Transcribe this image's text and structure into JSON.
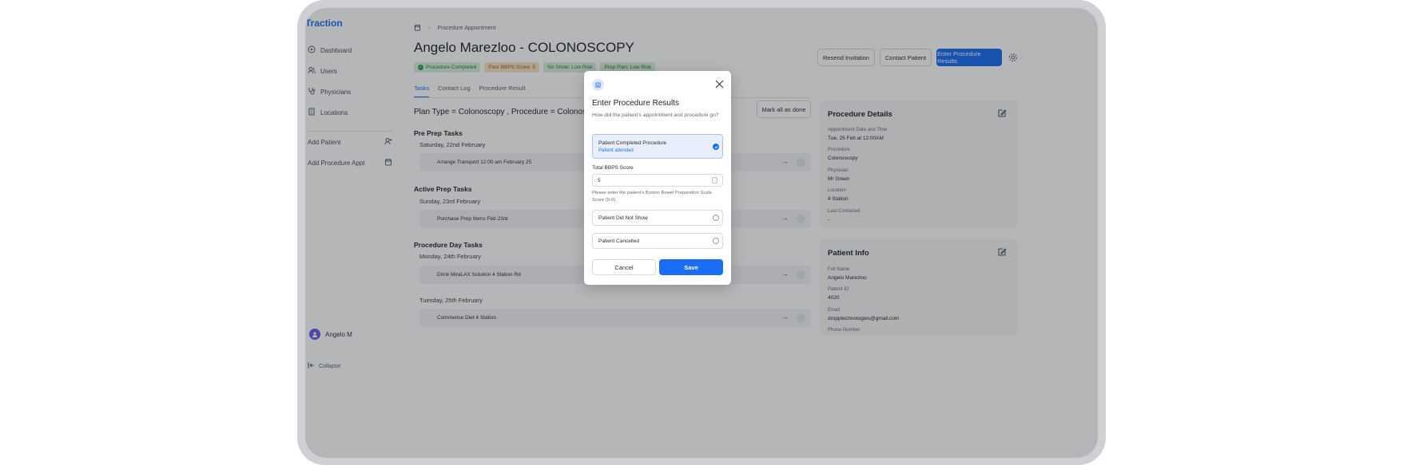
{
  "sidebar": {
    "brand": "Traction",
    "items": [
      {
        "label": "Dashboard",
        "icon": "dashboard-icon"
      },
      {
        "label": "Users",
        "icon": "users-icon"
      },
      {
        "label": "Physicians",
        "icon": "stethoscope-icon"
      },
      {
        "label": "Locations",
        "icon": "building-icon"
      }
    ],
    "actions": [
      {
        "label": "Add Patient",
        "icon": "user-plus-icon"
      },
      {
        "label": "Add Procedure Appt",
        "icon": "calendar-icon"
      }
    ],
    "user_name": "Angelo M",
    "collapse_label": "Collapse"
  },
  "header": {
    "breadcrumb": "Procedure Appointment",
    "title": "Angelo Marezloo - COLONOSCOPY",
    "badges": [
      {
        "label": "Procedure Completed"
      },
      {
        "label": "Poor BBPS Score: 5"
      },
      {
        "label": "No Show: Low Risk"
      },
      {
        "label": "Prep Plan: Low Risk"
      }
    ],
    "resend_label": "Resend Invitation",
    "contact_label": "Contact Patient",
    "enter_results_label": "Enter Procedure Results"
  },
  "tabs": [
    "Tasks",
    "Contact Log",
    "Procedure Result"
  ],
  "tasks": {
    "plan_type": "Plan Type = Colonoscopy , Procedure = Colonoscopy",
    "mark_all_label": "Mark all as done",
    "sections": [
      {
        "title": "Pre Prep Tasks",
        "dates": [
          {
            "date": "Saturday, 22nd February",
            "tasks": [
              "Arrange Transport 12:00 am February 25"
            ]
          }
        ]
      },
      {
        "title": "Active Prep Tasks",
        "dates": [
          {
            "date": "Sunday, 23rd February",
            "tasks": [
              "Purchase Prep Items Feb 23rd"
            ]
          }
        ]
      },
      {
        "title": "Procedure Day Tasks",
        "dates": [
          {
            "date": "Monday, 24th February",
            "tasks": [
              "Drink MiraLAX Solution 4 Station Rd"
            ]
          },
          {
            "date": "Tuesday, 25th February",
            "tasks": [
              "Commence Diet 4 Station"
            ]
          }
        ]
      }
    ]
  },
  "procedure_details": {
    "title": "Procedure Details",
    "fields": [
      {
        "label": "Appointment Date and Time",
        "value": "Tue, 25 Feb at 12:00AM"
      },
      {
        "label": "Procedure",
        "value": "Colonoscopy"
      },
      {
        "label": "Physician",
        "value": "Mr Green"
      },
      {
        "label": "Location",
        "value": "4 Station"
      },
      {
        "label": "Last Contacted",
        "value": "-"
      }
    ]
  },
  "patient_info": {
    "title": "Patient Info",
    "fields": [
      {
        "label": "Full Name",
        "value": "Angelo Marezloo"
      },
      {
        "label": "Patient ID",
        "value": "4020"
      },
      {
        "label": "Email",
        "value": "dropptechnologies@gmail.com"
      },
      {
        "label": "Phone Number",
        "value": ""
      }
    ]
  },
  "modal": {
    "title": "Enter Procedure Results",
    "subtitle": "How did the patient's appointment and procedure go?",
    "options": [
      {
        "label": "Patient Completed Procedure",
        "sublabel": "Patient attended",
        "selected": true
      },
      {
        "label": "Patient Did Not Show",
        "selected": false
      },
      {
        "label": "Patient Cancelled",
        "selected": false
      }
    ],
    "bbps_label": "Total BBPS Score",
    "bbps_value": "5",
    "bbps_help": "Please enter the patient's Boston Bowel Preparation Scale Score (0-9).",
    "cancel_label": "Cancel",
    "save_label": "Save"
  },
  "colors": {
    "accent": "#1a6ef5",
    "success": "#237a45",
    "warning": "#9a5b12"
  }
}
